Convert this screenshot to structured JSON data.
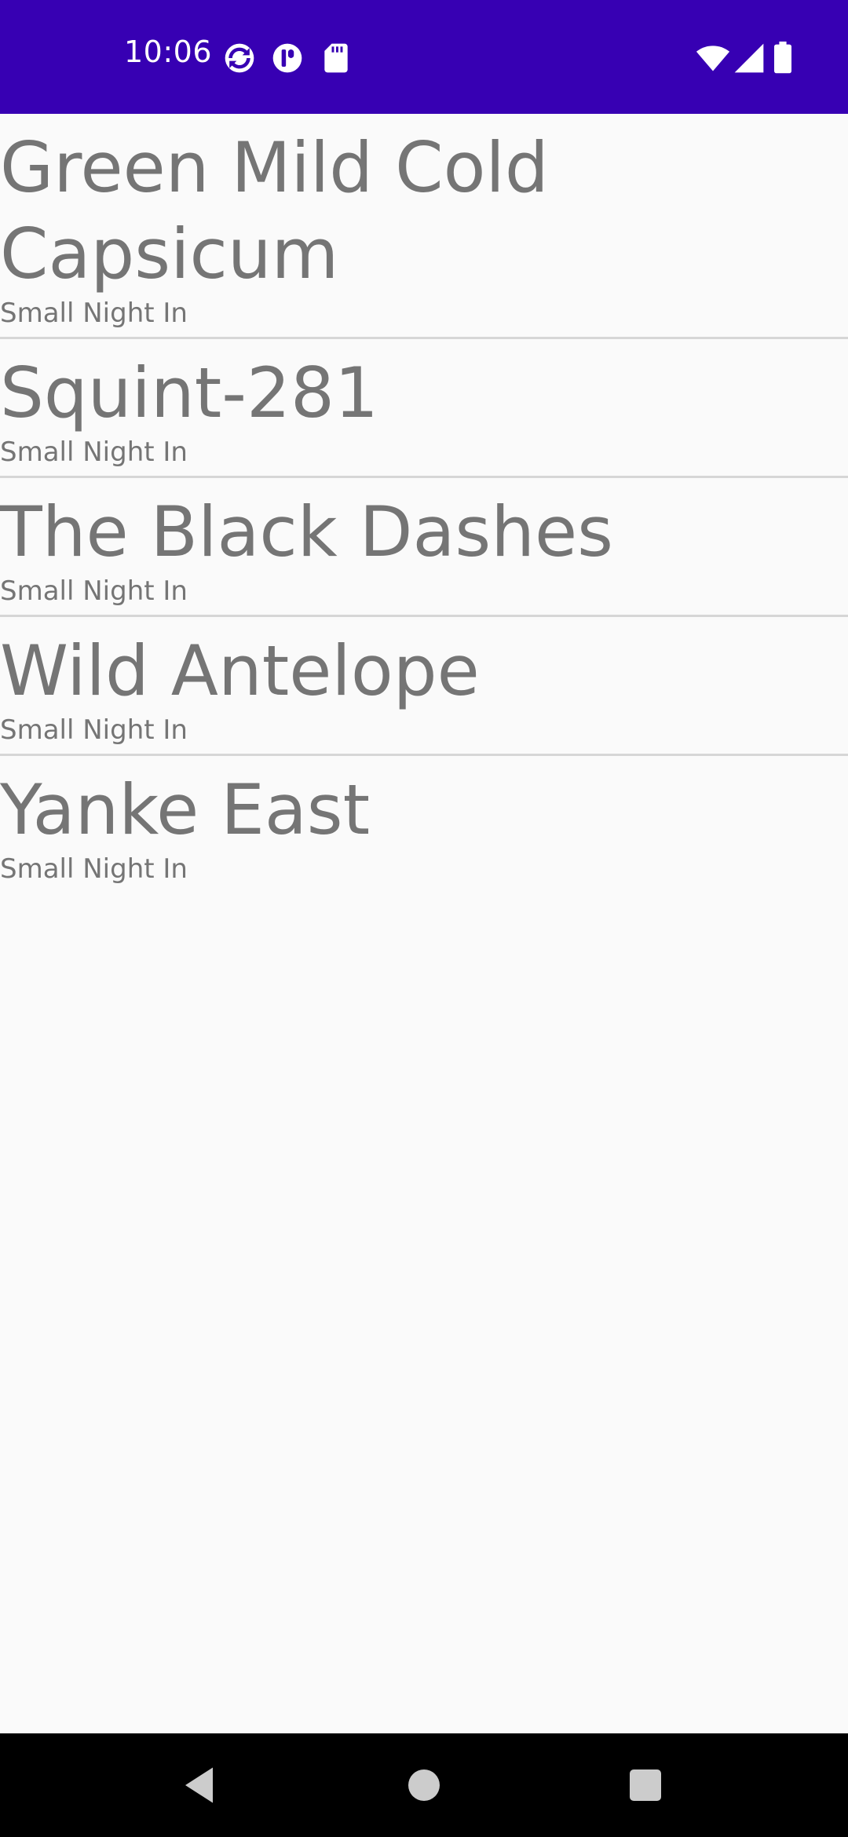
{
  "status_bar": {
    "time": "10:06",
    "left_icons": [
      "sync-icon",
      "app-notification-icon",
      "sd-card-icon"
    ],
    "right_icons": [
      "wifi-icon",
      "cell-signal-icon",
      "battery-icon"
    ],
    "background": "#3700b3"
  },
  "list": {
    "items": [
      {
        "title": "Green Mild Cold Capsicum",
        "subtitle": "Small Night In"
      },
      {
        "title": "Squint-281",
        "subtitle": "Small Night In"
      },
      {
        "title": "The Black Dashes",
        "subtitle": "Small Night In"
      },
      {
        "title": "Wild Antelope",
        "subtitle": "Small Night In"
      },
      {
        "title": "Yanke East",
        "subtitle": "Small Night In"
      }
    ]
  },
  "nav_bar": {
    "buttons": [
      "back-icon",
      "home-icon",
      "recents-icon"
    ]
  }
}
